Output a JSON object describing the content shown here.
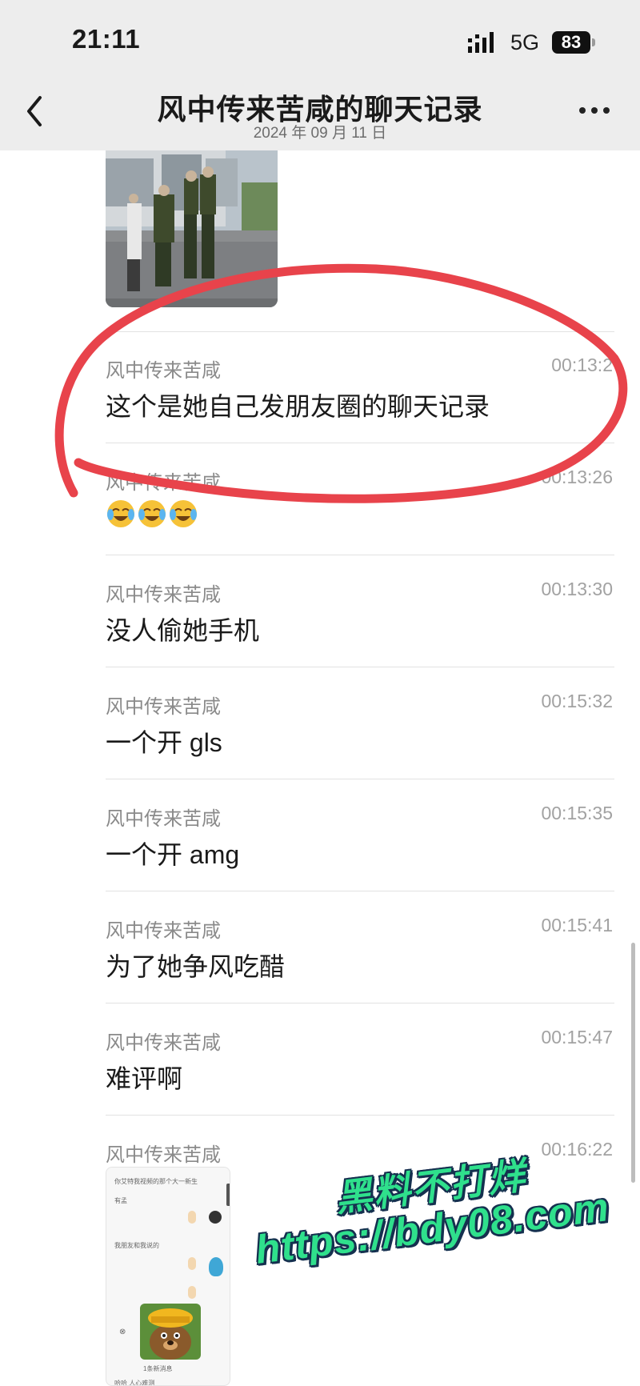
{
  "status_bar": {
    "time": "21:11",
    "network": "5G",
    "battery": "83"
  },
  "nav": {
    "title": "风中传来苦咸的聊天记录",
    "subtitle": "2024 年 09 月 11 日"
  },
  "messages": [
    {
      "sender": "风中传来苦咸",
      "time": "00:13:2",
      "text": "这个是她自己发朋友圈的聊天记录"
    },
    {
      "sender": "风中传来苦咸",
      "time": "00:13:26",
      "emoji": [
        "crying-laughing-emoji",
        "crying-laughing-emoji",
        "crying-laughing-emoji"
      ]
    },
    {
      "sender": "风中传来苦咸",
      "time": "00:13:30",
      "text": "没人偷她手机"
    },
    {
      "sender": "风中传来苦咸",
      "time": "00:15:32",
      "text": "一个开 gls"
    },
    {
      "sender": "风中传来苦咸",
      "time": "00:15:35",
      "text": "一个开 amg"
    },
    {
      "sender": "风中传来苦咸",
      "time": "00:15:41",
      "text": "为了她争风吃醋"
    },
    {
      "sender": "风中传来苦咸",
      "time": "00:15:47",
      "text": "难评啊"
    },
    {
      "sender": "风中传来苦咸",
      "time": "00:16:22"
    }
  ],
  "embedded_screenshot": {
    "lines": [
      "你艾特我视频的那个大一新生",
      "有孟",
      "我朋友和我说的",
      "1条新消息",
      "哈哈 人心难测"
    ]
  },
  "watermark": {
    "line1": "黑料不打烊",
    "line2": "https://bdy08.com"
  },
  "colors": {
    "nav_bg": "#ededed",
    "red_annotation": "#e8434b",
    "watermark_fill": "#2fe08c",
    "watermark_outline": "#15304f"
  }
}
